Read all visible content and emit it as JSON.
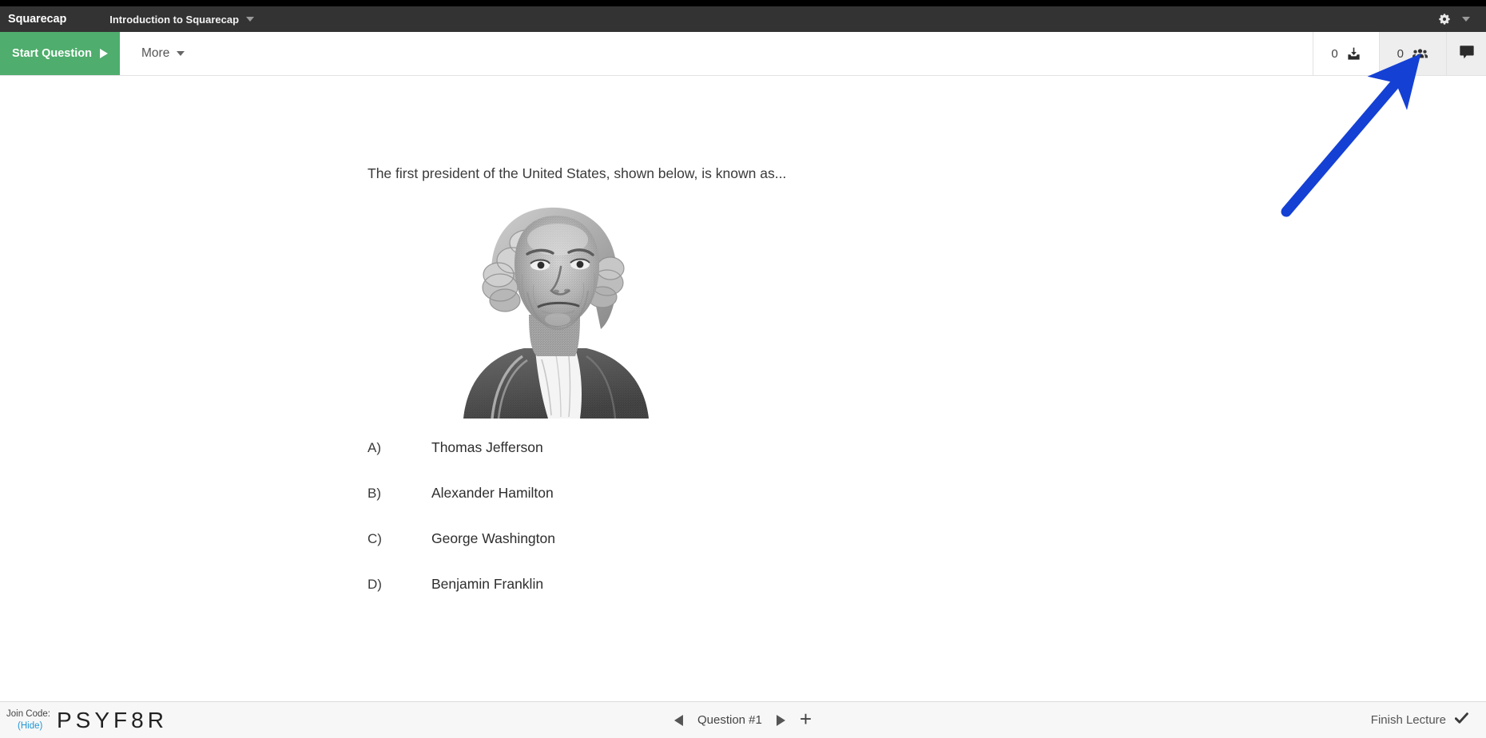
{
  "header": {
    "brand": "Squarecap",
    "course_title": "Introduction to Squarecap",
    "course_dropdown_icon": "chevron-down-icon",
    "settings_icon": "gear-icon",
    "settings_dropdown_icon": "chevron-down-icon"
  },
  "toolbar": {
    "start_question_label": "Start Question",
    "start_question_icon": "play-icon",
    "start_question_color": "#4FAD6D",
    "more_label": "More",
    "more_dropdown_icon": "chevron-down-icon",
    "downloads_count": "0",
    "downloads_icon": "download-inbox-icon",
    "participants_count": "0",
    "participants_icon": "people-group-icon",
    "chat_icon": "chat-bubble-icon"
  },
  "slide": {
    "question_text": "The first president of the United States, shown below, is known as...",
    "figure_alt": "George Washington portrait engraving from the one dollar bill",
    "answers": [
      {
        "letter": "A)",
        "text": "Thomas Jefferson"
      },
      {
        "letter": "B)",
        "text": "Alexander Hamilton"
      },
      {
        "letter": "C)",
        "text": "George Washington"
      },
      {
        "letter": "D)",
        "text": "Benjamin Franklin"
      }
    ]
  },
  "footer": {
    "join_code_label": "Join Code:",
    "join_code_hide_label": "(Hide)",
    "join_code_value": "PSYF8R",
    "prev_icon": "triangle-left-icon",
    "question_label": "Question #1",
    "next_icon": "triangle-right-icon",
    "add_icon": "plus-icon",
    "finish_label": "Finish Lecture",
    "finish_icon": "checkmark-icon"
  },
  "annotation": {
    "arrow_color": "#1440D4",
    "arrow_target": "participants-counter"
  }
}
